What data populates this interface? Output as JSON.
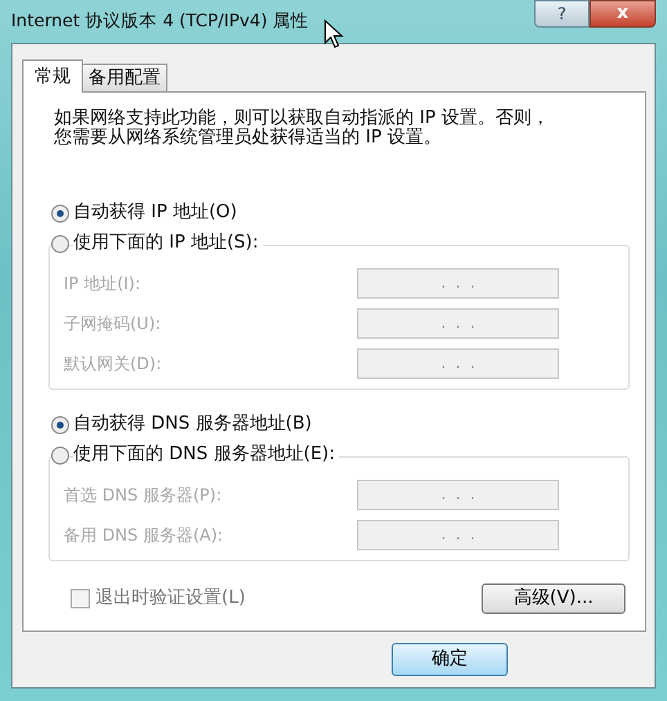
{
  "window": {
    "title": "Internet 协议版本 4 (TCP/IPv4) 属性",
    "help_button": "?",
    "close_button": "x"
  },
  "tabs": [
    {
      "label": "常规",
      "selected": true
    },
    {
      "label": "备用配置",
      "selected": false
    }
  ],
  "description": [
    "如果网络支持此功能，则可以获取自动指派的 IP 设置。否则，",
    "您需要从网络系统管理员处获得适当的 IP 设置。"
  ],
  "ip_section": {
    "radios": [
      {
        "label": "自动获得 IP 地址(O)",
        "selected": true
      },
      {
        "label": "使用下面的 IP 地址(S):",
        "selected": false
      }
    ],
    "fields": [
      {
        "label": "IP 地址(I):",
        "value": ".  .  .",
        "disabled": true
      },
      {
        "label": "子网掩码(U):",
        "value": ".  .  .",
        "disabled": true
      },
      {
        "label": "默认网关(D):",
        "value": ".  .  .",
        "disabled": true
      }
    ]
  },
  "dns_section": {
    "radios": [
      {
        "label": "自动获得 DNS 服务器地址(B)",
        "selected": true
      },
      {
        "label": "使用下面的 DNS 服务器地址(E):",
        "selected": false
      }
    ],
    "fields": [
      {
        "label": "首选 DNS 服务器(P):",
        "value": ".  .  .",
        "disabled": true
      },
      {
        "label": "备用 DNS 服务器(A):",
        "value": ".  .  .",
        "disabled": true
      }
    ]
  },
  "validate_checkbox": {
    "label": "退出时验证设置(L)",
    "checked": false,
    "disabled": true
  },
  "advanced_button": "高级(V)...",
  "ok_button": "确定"
}
